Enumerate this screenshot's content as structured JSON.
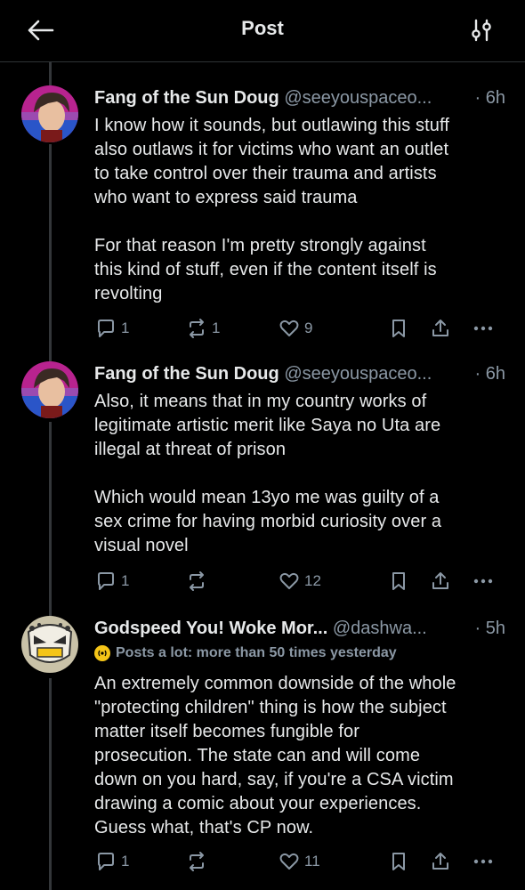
{
  "header": {
    "title": "Post",
    "back_icon": "back-arrow-icon",
    "filter_icon": "sliders-icon"
  },
  "posts": [
    {
      "name": "Fang of the Sun Doug",
      "handle": "@seeyouspaceo...",
      "time": "· 6h",
      "text": "I know how it sounds, but outlawing this stuff\nalso outlaws it for victims who want an outlet\nto take control over their trauma and artists\nwho want to express said trauma\n\nFor that reason I'm pretty strongly against\nthis kind of stuff, even if the content itself is\nrevolting",
      "replies": "1",
      "reposts": "1",
      "likes": "9"
    },
    {
      "name": "Fang of the Sun Doug",
      "handle": "@seeyouspaceo...",
      "time": "· 6h",
      "text": "Also, it means that in my country works of\nlegitimate artistic merit like Saya no Uta are\nillegal at threat of prison\n\nWhich would mean 13yo me was guilty of a\nsex crime for having morbid curiosity over a\nvisual novel",
      "replies": "1",
      "reposts": "",
      "likes": "12"
    },
    {
      "name": "Godspeed You! Woke Mor...",
      "handle": "@dashwa...",
      "time": "· 5h",
      "badge": "Posts a lot: more than 50 times yesterday",
      "text": "An extremely common downside of the whole\n\"protecting children\" thing is how the subject\nmatter itself becomes fungible for\nprosecution. The state can and will come\ndown on you hard, say, if you're a CSA victim\ndrawing a comic about your experiences.\nGuess what, that's CP now.",
      "replies": "1",
      "reposts": "",
      "likes": "11"
    }
  ],
  "colors": {
    "background": "#000000",
    "text": "#e7e9ea",
    "muted": "#8b98a5",
    "line": "#333639",
    "badge": "#f5c518"
  }
}
